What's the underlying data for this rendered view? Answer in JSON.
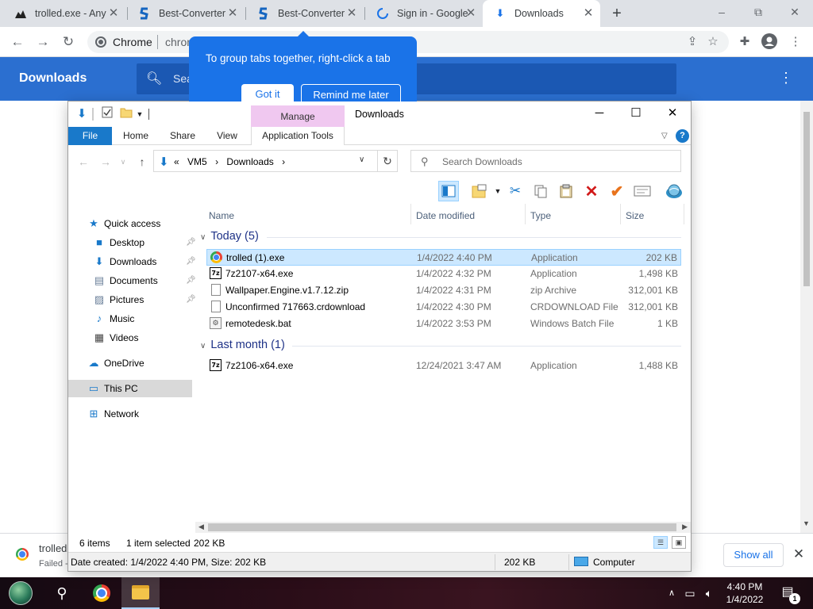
{
  "browser": {
    "tabs": [
      {
        "title": "trolled.exe - Any",
        "icon": "user-silhouette-icon"
      },
      {
        "title": "Best-Converter",
        "icon": "s-logo-icon"
      },
      {
        "title": "Best-Converter",
        "icon": "s-logo-icon"
      },
      {
        "title": "Sign in - Google",
        "icon": "loading-spinner-icon"
      },
      {
        "title": "Downloads",
        "icon": "download-icon"
      }
    ],
    "omnibox": {
      "label": "Chrome",
      "url": "chrome"
    },
    "window_controls": {
      "minimize": "–",
      "restore": "⧉",
      "close": "✕"
    }
  },
  "tooltip": {
    "text": "To group tabs together, right-click a tab",
    "got_it": "Got it",
    "remind_later": "Remind me later"
  },
  "downloads_page": {
    "title": "Downloads",
    "search_placeholder": "Search downloads",
    "search_visible": "Sea"
  },
  "shelf": {
    "file_name": "trolled",
    "status": "Failed -",
    "show_all": "Show all"
  },
  "explorer": {
    "title": "Downloads",
    "manage": "Manage",
    "ribbon_tabs": [
      "File",
      "Home",
      "Share",
      "View",
      "Application Tools"
    ],
    "address": {
      "chevron": "«",
      "parts": [
        "VM5",
        "Downloads"
      ],
      "separator": "›"
    },
    "search_placeholder": "Search Downloads",
    "nav": {
      "quick_access": "Quick access",
      "items": [
        "Desktop",
        "Downloads",
        "Documents",
        "Pictures",
        "Music",
        "Videos"
      ],
      "onedrive": "OneDrive",
      "this_pc": "This PC",
      "network": "Network"
    },
    "columns": [
      "Name",
      "Date modified",
      "Type",
      "Size"
    ],
    "groups": [
      {
        "label": "Today (5)",
        "files": [
          {
            "name": "trolled (1).exe",
            "date": "1/4/2022 4:40 PM",
            "type": "Application",
            "size": "202 KB",
            "icon": "chrome"
          },
          {
            "name": "7z2107-x64.exe",
            "date": "1/4/2022 4:32 PM",
            "type": "Application",
            "size": "1,498 KB",
            "icon": "7z"
          },
          {
            "name": "Wallpaper.Engine.v1.7.12.zip",
            "date": "1/4/2022 4:31 PM",
            "type": "zip Archive",
            "size": "312,001 KB",
            "icon": "doc"
          },
          {
            "name": "Unconfirmed 717663.crdownload",
            "date": "1/4/2022 4:30 PM",
            "type": "CRDOWNLOAD File",
            "size": "312,001 KB",
            "icon": "doc"
          },
          {
            "name": "remotedesk.bat",
            "date": "1/4/2022 3:53 PM",
            "type": "Windows Batch File",
            "size": "1 KB",
            "icon": "bat"
          }
        ]
      },
      {
        "label": "Last month (1)",
        "files": [
          {
            "name": "7z2106-x64.exe",
            "date": "12/24/2021 3:47 AM",
            "type": "Application",
            "size": "1,488 KB",
            "icon": "7z"
          }
        ]
      }
    ],
    "status": {
      "items": "6 items",
      "selected": "1 item selected",
      "size": "202 KB"
    },
    "details": {
      "created": "Date created: 1/4/2022 4:40 PM, Size: 202 KB",
      "size": "202 KB",
      "location": "Computer"
    }
  },
  "taskbar": {
    "time": "4:40 PM",
    "date": "1/4/2022",
    "notification_count": "1"
  },
  "colors": {
    "chrome_blue": "#1a73e8",
    "downloads_header": "#2b6fd0",
    "explorer_selection": "#cce8ff",
    "manage_context": "#f0c8f0"
  }
}
